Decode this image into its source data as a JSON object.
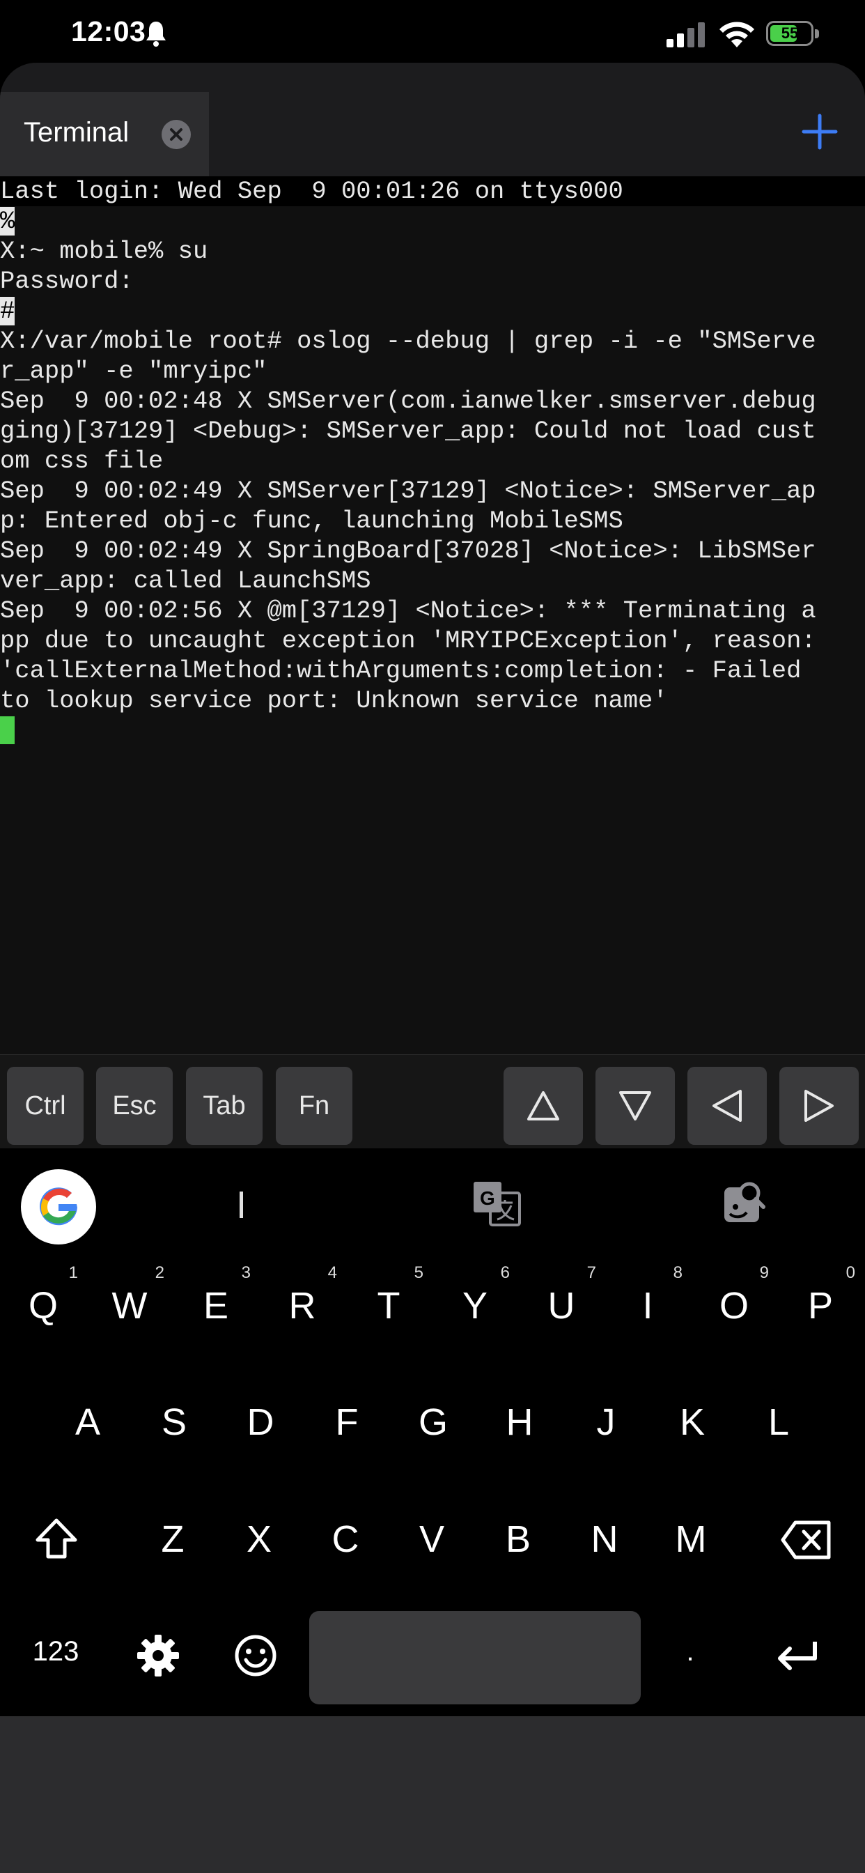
{
  "status_bar": {
    "time": "12:03",
    "battery_percent": "55",
    "icons": [
      "bell-icon",
      "cellular-signal-icon",
      "wifi-icon",
      "battery-icon"
    ]
  },
  "tab": {
    "label": "Terminal",
    "close_icon": "close-icon",
    "new_tab_icon": "plus-icon"
  },
  "terminal": {
    "lines": [
      "Last login: Wed Sep  9 00:01:26 on ttys000",
      "%",
      "X:~ mobile% su",
      "Password:",
      "#",
      "X:/var/mobile root# oslog --debug | grep -i -e \"SMServe",
      "r_app\" -e \"mryipc\"",
      "Sep  9 00:02:48 X SMServer(com.ianwelker.smserver.debug",
      "ging)[37129] <Debug>: SMServer_app: Could not load cust",
      "om css file",
      "Sep  9 00:02:49 X SMServer[37129] <Notice>: SMServer_ap",
      "p: Entered obj-c func, launching MobileSMS",
      "Sep  9 00:02:49 X SpringBoard[37028] <Notice>: LibSMSer",
      "ver_app: called LaunchSMS",
      "Sep  9 00:02:56 X @m[37129] <Notice>: *** Terminating a",
      "pp due to uncaught exception 'MRYIPCException', reason:",
      "'callExternalMethod:withArguments:completion: - Failed",
      "to lookup service port: Unknown service name'"
    ]
  },
  "key_bar": {
    "ctrl": "Ctrl",
    "esc": "Esc",
    "tab": "Tab",
    "fn": "Fn",
    "arrow_icons": [
      "arrow-up-icon",
      "arrow-down-icon",
      "arrow-left-icon",
      "arrow-right-icon"
    ]
  },
  "keyboard": {
    "row1": [
      "Q",
      "W",
      "E",
      "R",
      "T",
      "Y",
      "U",
      "I",
      "O",
      "P"
    ],
    "row1_hints": [
      "1",
      "2",
      "3",
      "4",
      "5",
      "6",
      "7",
      "8",
      "9",
      "0"
    ],
    "row2": [
      "A",
      "S",
      "D",
      "F",
      "G",
      "H",
      "J",
      "K",
      "L"
    ],
    "row3": [
      "Z",
      "X",
      "C",
      "V",
      "B",
      "N",
      "M"
    ],
    "numbers_key": "123",
    "period_key": ".",
    "suggestion_icons": [
      "google-logo-icon",
      "translate-icon",
      "lens-search-icon"
    ],
    "bottom_icons": [
      "shift-icon",
      "backspace-icon",
      "settings-gear-icon",
      "emoji-icon",
      "enter-icon"
    ]
  }
}
